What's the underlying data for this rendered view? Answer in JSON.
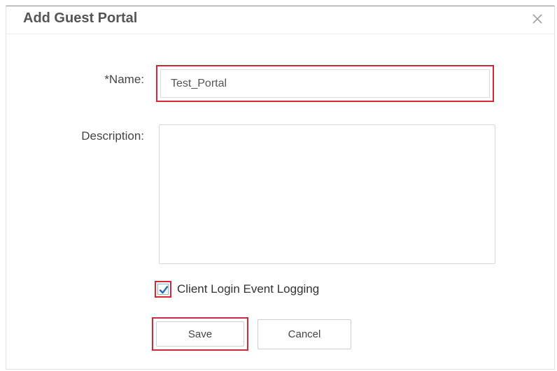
{
  "dialog": {
    "title": "Add Guest Portal",
    "close_icon": "close-icon"
  },
  "form": {
    "name": {
      "label": "*Name:",
      "value": "Test_Portal"
    },
    "description": {
      "label": "Description:",
      "value": ""
    },
    "client_login_logging": {
      "label": "Client Login Event Logging",
      "checked": true,
      "icon": "checkmark-icon"
    }
  },
  "buttons": {
    "save_label": "Save",
    "cancel_label": "Cancel"
  },
  "colors": {
    "highlight": "#d4283a",
    "checkmark": "#1a6fc4"
  }
}
